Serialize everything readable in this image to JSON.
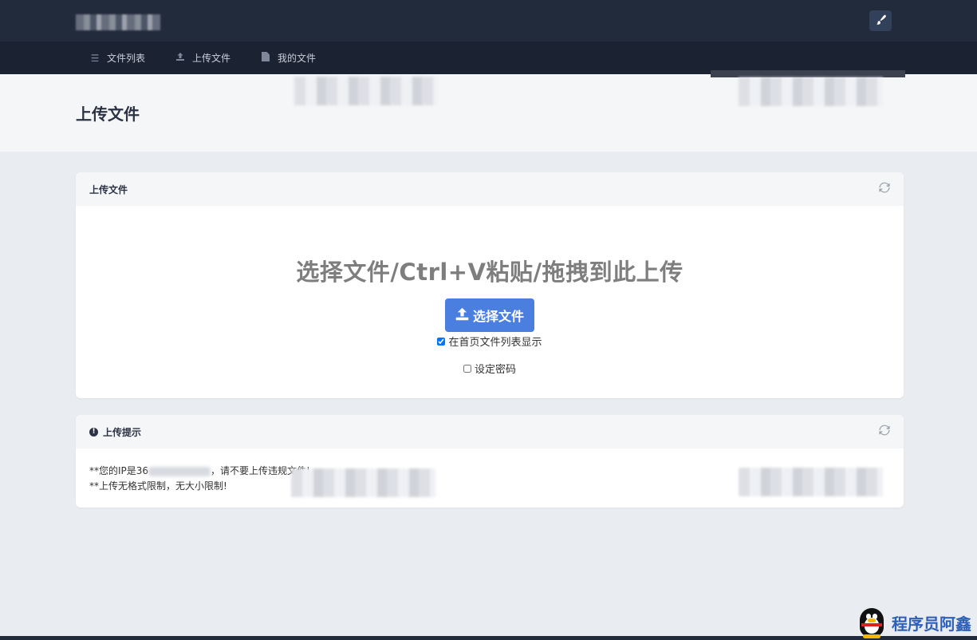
{
  "header": {
    "brush_icon": "brush-icon"
  },
  "nav": {
    "items": [
      {
        "label": "文件列表",
        "icon": "list-icon"
      },
      {
        "label": "上传文件",
        "icon": "upload-icon"
      },
      {
        "label": "我的文件",
        "icon": "file-icon"
      }
    ]
  },
  "page": {
    "title": "上传文件"
  },
  "upload_card": {
    "title": "上传文件",
    "drop_text": "选择文件/Ctrl+V粘贴/拖拽到此上传",
    "choose_button": "选择文件",
    "show_on_homepage_label": "在首页文件列表显示",
    "show_on_homepage_checked": true,
    "set_password_label": "设定密码",
    "set_password_checked": false
  },
  "tips_card": {
    "title": "上传提示",
    "line1_prefix": "**您的IP是36",
    "line1_suffix": "，请不要上传违规文件!",
    "line2": "**上传无格式限制，无大小限制!"
  },
  "watermark": {
    "text": "程序员阿鑫"
  }
}
